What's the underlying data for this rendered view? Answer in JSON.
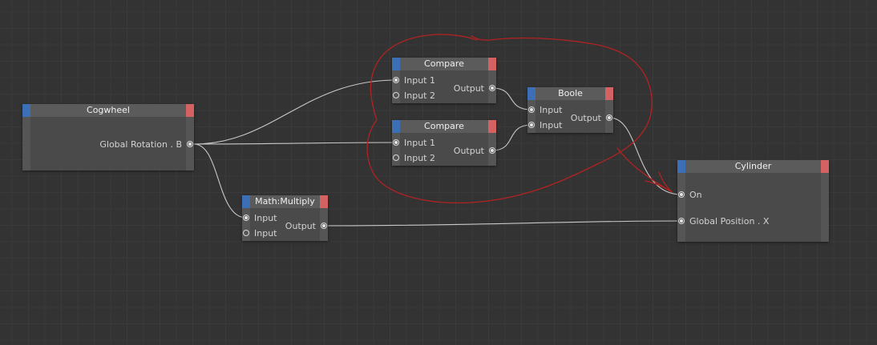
{
  "colors": {
    "background": "#333333",
    "node_body": "#4a4a4a",
    "node_header": "#5b5b5b",
    "cap_left": "#3d6fb6",
    "cap_right": "#d46262",
    "wire": "#c8c8c8",
    "annotation": "#b32222"
  },
  "nodes": {
    "cogwheel": {
      "title": "Cogwheel",
      "outputs": [
        "Global Rotation . B"
      ]
    },
    "compare1": {
      "title": "Compare",
      "inputs": [
        "Input 1",
        "Input 2"
      ],
      "outputs": [
        "Output"
      ]
    },
    "compare2": {
      "title": "Compare",
      "inputs": [
        "Input 1",
        "Input 2"
      ],
      "outputs": [
        "Output"
      ]
    },
    "boole": {
      "title": "Boole",
      "inputs": [
        "Input",
        "Input"
      ],
      "outputs": [
        "Output"
      ]
    },
    "multiply": {
      "title": "Math:Multiply",
      "inputs": [
        "Input",
        "Input"
      ],
      "outputs": [
        "Output"
      ]
    },
    "cylinder": {
      "title": "Cylinder",
      "inputs": [
        "On",
        "Global Position . X"
      ]
    }
  }
}
